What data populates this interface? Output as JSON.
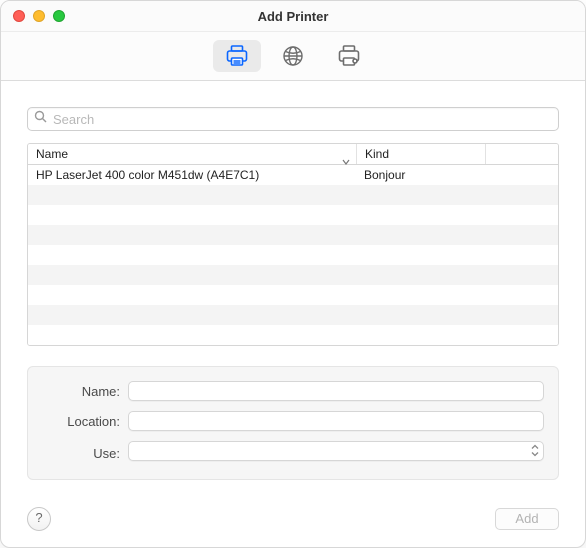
{
  "window": {
    "title": "Add Printer"
  },
  "toolbar": {
    "tabs": [
      {
        "name": "default-tab",
        "active": true
      },
      {
        "name": "ip-tab",
        "active": false
      },
      {
        "name": "advanced-tab",
        "active": false
      }
    ]
  },
  "search": {
    "placeholder": "Search",
    "value": ""
  },
  "table": {
    "headers": {
      "name": "Name",
      "kind": "Kind"
    },
    "rows": [
      {
        "name": "HP LaserJet 400 color M451dw (A4E7C1)",
        "kind": "Bonjour"
      }
    ],
    "visible_row_count": 9
  },
  "form": {
    "name": {
      "label": "Name:",
      "value": ""
    },
    "location": {
      "label": "Location:",
      "value": ""
    },
    "use": {
      "label": "Use:",
      "value": ""
    }
  },
  "footer": {
    "help_label": "?",
    "add_label": "Add",
    "add_enabled": false
  }
}
